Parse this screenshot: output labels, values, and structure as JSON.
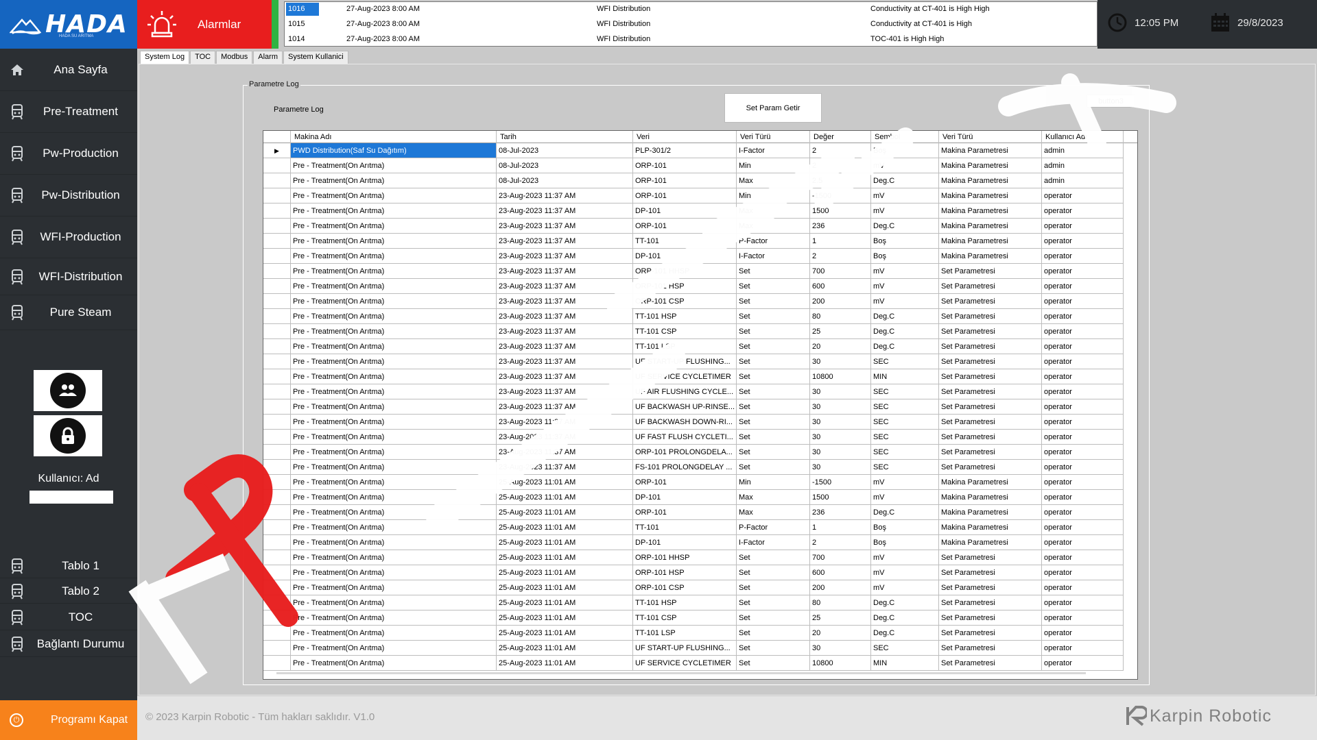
{
  "app": {
    "brand": "HADA",
    "brand_sub": "HADA SU ARITMA"
  },
  "sidebar": {
    "items": [
      {
        "label": "Ana Sayfa",
        "icon": "home-icon"
      },
      {
        "label": "Pre-Treatment",
        "icon": "machine-icon"
      },
      {
        "label": "Pw-Production",
        "icon": "machine-icon"
      },
      {
        "label": "Pw-Distribution",
        "icon": "machine-icon"
      },
      {
        "label": "WFI-Production",
        "icon": "machine-icon"
      },
      {
        "label": "WFI-Distribution",
        "icon": "machine-icon"
      },
      {
        "label": "Pure Steam",
        "icon": "machine-icon"
      }
    ],
    "user_label": "Kullanıcı:",
    "user_value": "Ad",
    "bottom_items": [
      {
        "label": "Tablo 1",
        "icon": "machine-icon"
      },
      {
        "label": "Tablo 2",
        "icon": "machine-icon"
      },
      {
        "label": "TOC",
        "icon": "machine-icon"
      },
      {
        "label": "Bağlantı Durumu",
        "icon": "machine-icon"
      }
    ],
    "exit_label": "Programı Kapat"
  },
  "alarm": {
    "label": "Alarmlar",
    "rows": [
      {
        "id": "1016",
        "time": "27-Aug-2023 8:00 AM",
        "system": "WFI Distribution",
        "message": "Conductivity at CT-401 is High High"
      },
      {
        "id": "1015",
        "time": "27-Aug-2023 8:00 AM",
        "system": "WFI Distribution",
        "message": "Conductivity at CT-401 is High"
      },
      {
        "id": "1014",
        "time": "27-Aug-2023 8:00 AM",
        "system": "WFI Distribution",
        "message": "TOC-401 is High High"
      }
    ]
  },
  "topbar": {
    "time": "12:05 PM",
    "date": "29/8/2023"
  },
  "tabs": [
    "System Log",
    "TOC",
    "Modbus",
    "Alarm",
    "System Kullanici"
  ],
  "panel": {
    "group_title": "Parametre Log",
    "label": "Parametre Log",
    "button_fetch": "Set Param Getir",
    "button3": "button3"
  },
  "table": {
    "columns": [
      "Makina Adı",
      "Tarih",
      "Veri",
      "Veri Türü",
      "Değer",
      "Sembol",
      "Veri Türü",
      "Kullanıcı Adı"
    ],
    "rows": [
      [
        "PWD Distribution(Saf Su Dağıtım)",
        "08-Jul-2023",
        "PLP-301/2",
        "I-Factor",
        "2",
        "Boş",
        "Makina Parametresi",
        "admin"
      ],
      [
        "Pre - Treatment(On Arıtma)",
        "08-Jul-2023",
        "ORP-101",
        "Min",
        "2",
        "mV",
        "Makina Parametresi",
        "admin"
      ],
      [
        "Pre - Treatment(On Arıtma)",
        "08-Jul-2023",
        "ORP-101",
        "Max",
        "2.5",
        "Deg.C",
        "Makina Parametresi",
        "admin"
      ],
      [
        "Pre - Treatment(On Arıtma)",
        "23-Aug-2023 11:37 AM",
        "ORP-101",
        "Min",
        "-1500",
        "mV",
        "Makina Parametresi",
        "operator"
      ],
      [
        "Pre - Treatment(On Arıtma)",
        "23-Aug-2023 11:37 AM",
        "DP-101",
        "Max",
        "1500",
        "mV",
        "Makina Parametresi",
        "operator"
      ],
      [
        "Pre - Treatment(On Arıtma)",
        "23-Aug-2023 11:37 AM",
        "ORP-101",
        "Max",
        "236",
        "Deg.C",
        "Makina Parametresi",
        "operator"
      ],
      [
        "Pre - Treatment(On Arıtma)",
        "23-Aug-2023 11:37 AM",
        "TT-101",
        "P-Factor",
        "1",
        "Boş",
        "Makina Parametresi",
        "operator"
      ],
      [
        "Pre - Treatment(On Arıtma)",
        "23-Aug-2023 11:37 AM",
        "DP-101",
        "I-Factor",
        "2",
        "Boş",
        "Makina Parametresi",
        "operator"
      ],
      [
        "Pre - Treatment(On Arıtma)",
        "23-Aug-2023 11:37 AM",
        "ORP-101 HHSP",
        "Set",
        "700",
        "mV",
        "Set Parametresi",
        "operator"
      ],
      [
        "Pre - Treatment(On Arıtma)",
        "23-Aug-2023 11:37 AM",
        "ORP-101 HSP",
        "Set",
        "600",
        "mV",
        "Set Parametresi",
        "operator"
      ],
      [
        "Pre - Treatment(On Arıtma)",
        "23-Aug-2023 11:37 AM",
        "ORP-101 CSP",
        "Set",
        "200",
        "mV",
        "Set Parametresi",
        "operator"
      ],
      [
        "Pre - Treatment(On Arıtma)",
        "23-Aug-2023 11:37 AM",
        "TT-101 HSP",
        "Set",
        "80",
        "Deg.C",
        "Set Parametresi",
        "operator"
      ],
      [
        "Pre - Treatment(On Arıtma)",
        "23-Aug-2023 11:37 AM",
        "TT-101 CSP",
        "Set",
        "25",
        "Deg.C",
        "Set Parametresi",
        "operator"
      ],
      [
        "Pre - Treatment(On Arıtma)",
        "23-Aug-2023 11:37 AM",
        "TT-101 LSP",
        "Set",
        "20",
        "Deg.C",
        "Set Parametresi",
        "operator"
      ],
      [
        "Pre - Treatment(On Arıtma)",
        "23-Aug-2023 11:37 AM",
        "UF START-UP FLUSHING...",
        "Set",
        "30",
        "SEC",
        "Set Parametresi",
        "operator"
      ],
      [
        "Pre - Treatment(On Arıtma)",
        "23-Aug-2023 11:37 AM",
        "UF SERVICE CYCLETIMER",
        "Set",
        "10800",
        "MIN",
        "Set Parametresi",
        "operator"
      ],
      [
        "Pre - Treatment(On Arıtma)",
        "23-Aug-2023 11:37 AM",
        "UF AIR FLUSHING CYCLE...",
        "Set",
        "30",
        "SEC",
        "Set Parametresi",
        "operator"
      ],
      [
        "Pre - Treatment(On Arıtma)",
        "23-Aug-2023 11:37 AM",
        "UF BACKWASH UP-RINSE...",
        "Set",
        "30",
        "SEC",
        "Set Parametresi",
        "operator"
      ],
      [
        "Pre - Treatment(On Arıtma)",
        "23-Aug-2023 11:37 AM",
        "UF BACKWASH DOWN-RI...",
        "Set",
        "30",
        "SEC",
        "Set Parametresi",
        "operator"
      ],
      [
        "Pre - Treatment(On Arıtma)",
        "23-Aug-2023 11:37 AM",
        "UF FAST FLUSH CYCLETI...",
        "Set",
        "30",
        "SEC",
        "Set Parametresi",
        "operator"
      ],
      [
        "Pre - Treatment(On Arıtma)",
        "23-Aug-2023 11:37 AM",
        "ORP-101 PROLONGDELA...",
        "Set",
        "30",
        "SEC",
        "Set Parametresi",
        "operator"
      ],
      [
        "Pre - Treatment(On Arıtma)",
        "23-Aug-2023 11:37 AM",
        "FS-101 PROLONGDELAY ...",
        "Set",
        "30",
        "SEC",
        "Set Parametresi",
        "operator"
      ],
      [
        "Pre - Treatment(On Arıtma)",
        "25-Aug-2023 11:01 AM",
        "ORP-101",
        "Min",
        "-1500",
        "mV",
        "Makina Parametresi",
        "operator"
      ],
      [
        "Pre - Treatment(On Arıtma)",
        "25-Aug-2023 11:01 AM",
        "DP-101",
        "Max",
        "1500",
        "mV",
        "Makina Parametresi",
        "operator"
      ],
      [
        "Pre - Treatment(On Arıtma)",
        "25-Aug-2023 11:01 AM",
        "ORP-101",
        "Max",
        "236",
        "Deg.C",
        "Makina Parametresi",
        "operator"
      ],
      [
        "Pre - Treatment(On Arıtma)",
        "25-Aug-2023 11:01 AM",
        "TT-101",
        "P-Factor",
        "1",
        "Boş",
        "Makina Parametresi",
        "operator"
      ],
      [
        "Pre - Treatment(On Arıtma)",
        "25-Aug-2023 11:01 AM",
        "DP-101",
        "I-Factor",
        "2",
        "Boş",
        "Makina Parametresi",
        "operator"
      ],
      [
        "Pre - Treatment(On Arıtma)",
        "25-Aug-2023 11:01 AM",
        "ORP-101 HHSP",
        "Set",
        "700",
        "mV",
        "Set Parametresi",
        "operator"
      ],
      [
        "Pre - Treatment(On Arıtma)",
        "25-Aug-2023 11:01 AM",
        "ORP-101 HSP",
        "Set",
        "600",
        "mV",
        "Set Parametresi",
        "operator"
      ],
      [
        "Pre - Treatment(On Arıtma)",
        "25-Aug-2023 11:01 AM",
        "ORP-101 CSP",
        "Set",
        "200",
        "mV",
        "Set Parametresi",
        "operator"
      ],
      [
        "Pre - Treatment(On Arıtma)",
        "25-Aug-2023 11:01 AM",
        "TT-101 HSP",
        "Set",
        "80",
        "Deg.C",
        "Set Parametresi",
        "operator"
      ],
      [
        "Pre - Treatment(On Arıtma)",
        "25-Aug-2023 11:01 AM",
        "TT-101 CSP",
        "Set",
        "25",
        "Deg.C",
        "Set Parametresi",
        "operator"
      ],
      [
        "Pre - Treatment(On Arıtma)",
        "25-Aug-2023 11:01 AM",
        "TT-101 LSP",
        "Set",
        "20",
        "Deg.C",
        "Set Parametresi",
        "operator"
      ],
      [
        "Pre - Treatment(On Arıtma)",
        "25-Aug-2023 11:01 AM",
        "UF START-UP FLUSHING...",
        "Set",
        "30",
        "SEC",
        "Set Parametresi",
        "operator"
      ],
      [
        "Pre - Treatment(On Arıtma)",
        "25-Aug-2023 11:01 AM",
        "UF SERVICE CYCLETIMER",
        "Set",
        "10800",
        "MIN",
        "Set Parametresi",
        "operator"
      ]
    ]
  },
  "footer": {
    "copyright": "© 2023 Karpin Robotic - Tüm hakları saklıdır. V1.0",
    "logo_text": "Karpin Robotic"
  },
  "colors": {
    "sidebar": "#2b2f33",
    "brand_blue": "#1565c0",
    "alarm_red": "#e81e1e",
    "selection": "#1e78d7",
    "exit_orange": "#f7821b",
    "status_green": "#2fb341"
  }
}
